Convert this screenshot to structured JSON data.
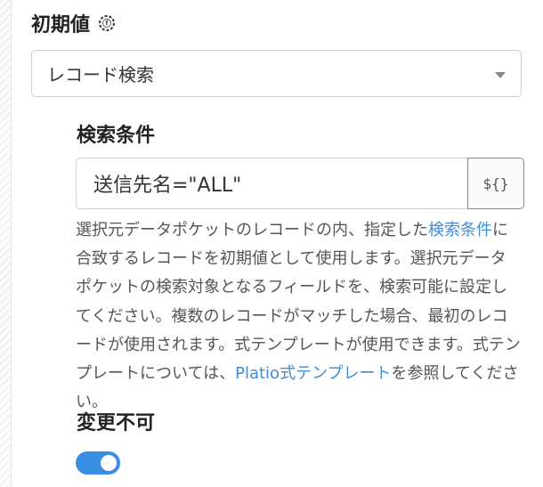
{
  "initial_value": {
    "title": "初期値",
    "icon": "formula-icon",
    "select_value": "レコード検索"
  },
  "search_condition": {
    "title": "検索条件",
    "value": "送信先名=\"ALL\"",
    "template_button_label": "${}"
  },
  "help": {
    "text1": "選択元データポケットのレコードの内、指定した",
    "link1": "検索条件",
    "text2": "に合致するレコードを初期値として使用します。選択元データポケットの検索対象となるフィールドを、検索可能に設定してください。複数のレコードがマッチした場合、最初のレコードが使用されます。式テンプレートが使用できます。式テンプレートについては、",
    "link2": "Platio式テンプレート",
    "text3": "を参照してください。"
  },
  "readonly": {
    "title": "変更不可",
    "toggle_on": true
  },
  "colors": {
    "link": "#3d8ddb",
    "toggle_on": "#3a8ee6"
  }
}
